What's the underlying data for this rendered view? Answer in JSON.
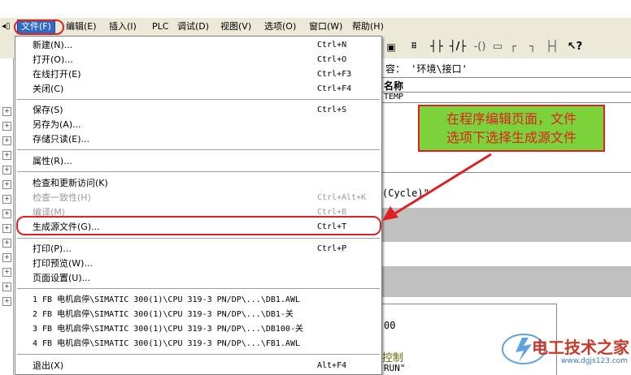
{
  "menubar": {
    "items": [
      {
        "label": "文件(F)"
      },
      {
        "label": "编辑(E)"
      },
      {
        "label": "插入(I)"
      },
      {
        "label": "PLC"
      },
      {
        "label": "调试(D)"
      },
      {
        "label": "视图(V)"
      },
      {
        "label": "选项(O)"
      },
      {
        "label": "窗口(W)"
      },
      {
        "label": "帮助(H)"
      }
    ]
  },
  "file_menu": {
    "group1": [
      {
        "label": "新建(N)...",
        "shortcut": "Ctrl+N"
      },
      {
        "label": "打开(O)...",
        "shortcut": "Ctrl+O"
      },
      {
        "label": "在线打开(E)",
        "shortcut": "Ctrl+F3"
      },
      {
        "label": "关闭(C)",
        "shortcut": "Ctrl+F4"
      }
    ],
    "group2": [
      {
        "label": "保存(S)",
        "shortcut": "Ctrl+S"
      },
      {
        "label": "另存为(A)...",
        "shortcut": ""
      },
      {
        "label": "存储只读(E)...",
        "shortcut": ""
      }
    ],
    "group3": [
      {
        "label": "属性(R)...",
        "shortcut": ""
      }
    ],
    "group4": [
      {
        "label": "检查和更新访问(K)",
        "shortcut": "",
        "disabled": false
      },
      {
        "label": "检查一致性(H)",
        "shortcut": "Ctrl+Alt+K",
        "disabled": true
      },
      {
        "label": "编译(M)",
        "shortcut": "Ctrl+B",
        "disabled": true
      },
      {
        "label": "生成源文件(G)...",
        "shortcut": "Ctrl+T",
        "disabled": false
      }
    ],
    "group5": [
      {
        "label": "打印(P)...",
        "shortcut": "Ctrl+P"
      },
      {
        "label": "打印预览(W)...",
        "shortcut": ""
      },
      {
        "label": "页面设置(U)...",
        "shortcut": ""
      }
    ],
    "recent": [
      {
        "label": "1 FB 电机启停\\SIMATIC 300(1)\\CPU 319-3 PN/DP\\...\\DB1.AWL"
      },
      {
        "label": "2 FB 电机启停\\SIMATIC 300(1)\\CPU 319-3 PN/DP\\...\\DB1-关"
      },
      {
        "label": "3 FB 电机启停\\SIMATIC 300(1)\\CPU 319-3 PN/DP\\...\\DB100-关"
      },
      {
        "label": "4 FB 电机启停\\SIMATIC 300(1)\\CPU 319-3 PN/DP\\...\\FB1.AWL"
      }
    ],
    "exit": {
      "label": "退出(X)",
      "shortcut": "Alt+F4"
    }
  },
  "toolbar": {
    "buttons": [
      {
        "icon": "monitor-icon",
        "glyph": "▣"
      },
      {
        "icon": "binary-icon",
        "glyph": "⠿"
      },
      {
        "icon": "nc-contact-icon",
        "glyph": "┤├"
      },
      {
        "icon": "no-contact-icon",
        "glyph": "┤/├"
      },
      {
        "icon": "coil-icon",
        "glyph": "-()"
      },
      {
        "icon": "box-icon",
        "glyph": "▭"
      },
      {
        "icon": "branch-open-icon",
        "glyph": "┌"
      },
      {
        "icon": "branch-close-icon",
        "glyph": "┐"
      },
      {
        "icon": "branch-icon",
        "glyph": "├┤"
      },
      {
        "icon": "help-cursor-icon",
        "glyph": "↖?"
      }
    ]
  },
  "editor": {
    "info_line": "容：  '环境\\接口'",
    "col_header": "名称",
    "temp_row": "TEMP",
    "cycle_line": "(Cycle)\"",
    "num_line": "00",
    "control_text": "控制",
    "run_text": "RUN\""
  },
  "callout": {
    "line1": "在程序编辑页面，文件",
    "line2": "选项下选择生成源文件"
  },
  "watermark": {
    "text": "电工技术之家",
    "url": "www.dgjs123.com"
  },
  "colors": {
    "menu_highlight": "#316ac5",
    "annotation_red": "#e02020",
    "callout_green": "#7bd23a"
  }
}
